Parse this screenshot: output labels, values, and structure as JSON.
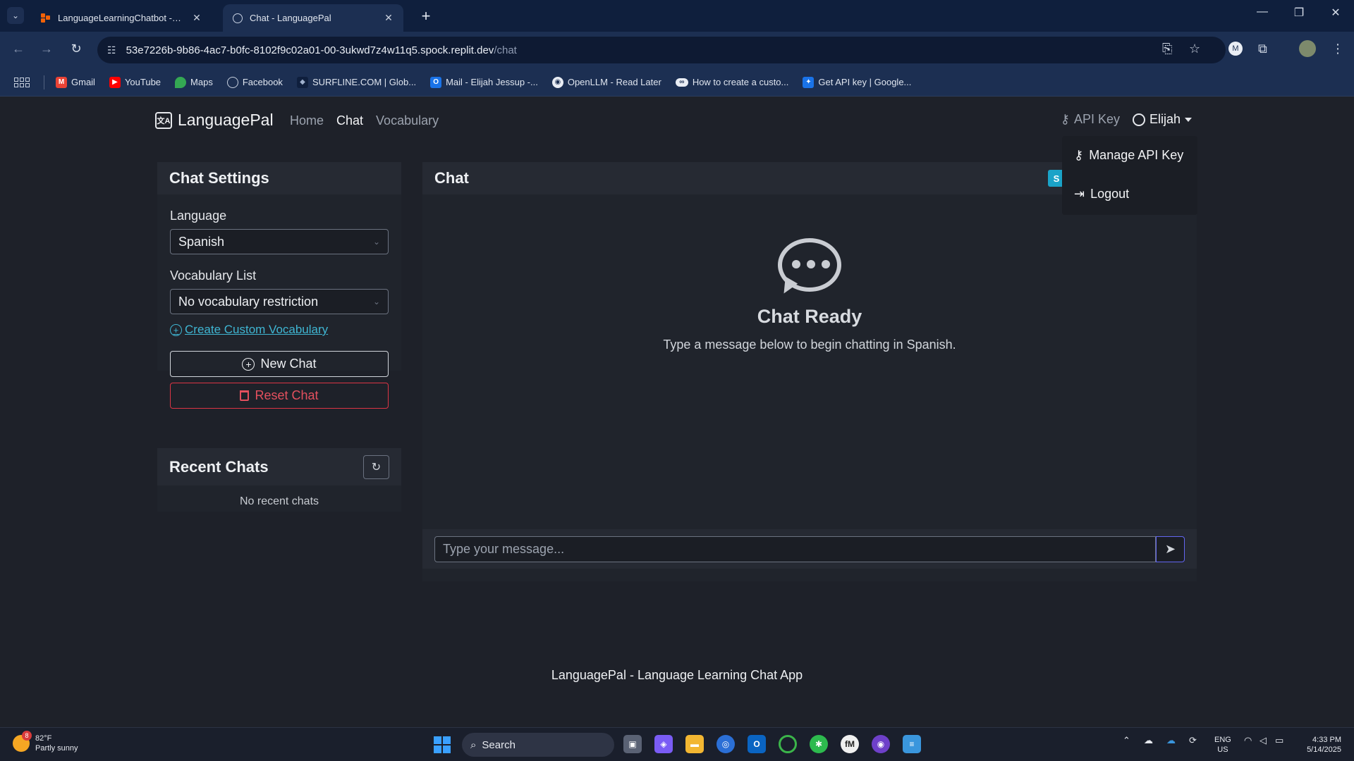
{
  "browser": {
    "tabs": [
      {
        "title": "LanguageLearningChatbot - Replit",
        "active": false
      },
      {
        "title": "Chat - LanguagePal",
        "active": true
      }
    ],
    "url_host": "53e7226b-9b86-4ac7-b0fc-8102f9c02a01-00-3ukwd7z4w11q5.spock.replit.dev",
    "url_path": "/chat",
    "bookmarks": [
      {
        "label": "Gmail",
        "icon": "gmail-icon",
        "color": "#ea4335"
      },
      {
        "label": "YouTube",
        "icon": "youtube-icon",
        "color": "#ff0000"
      },
      {
        "label": "Maps",
        "icon": "maps-icon",
        "color": "#34a853"
      },
      {
        "label": "Facebook",
        "icon": "globe-icon",
        "color": "#8a94a8"
      },
      {
        "label": "SURFLINE.COM | Glob...",
        "icon": "surfline-icon",
        "color": "#1f2b44"
      },
      {
        "label": "Mail - Elijah Jessup -...",
        "icon": "outlook-icon",
        "color": "#1a73e8"
      },
      {
        "label": "OpenLLM - Read Later",
        "icon": "github-icon",
        "color": "#2b2b2b"
      },
      {
        "label": "How to create a custo...",
        "icon": "link-icon",
        "color": "#444c5e"
      },
      {
        "label": "Get API key | Google...",
        "icon": "google-ai-icon",
        "color": "#1a73e8"
      }
    ]
  },
  "app": {
    "brand": "LanguagePal",
    "nav": {
      "home": "Home",
      "chat": "Chat",
      "vocabulary": "Vocabulary"
    },
    "api_key": "API Key",
    "user": "Elijah",
    "dropdown": {
      "manage_api_key": "Manage API Key",
      "logout": "Logout"
    },
    "settings": {
      "title": "Chat Settings",
      "language_label": "Language",
      "language_value": "Spanish",
      "vocab_label": "Vocabulary List",
      "vocab_value": "No vocabulary restriction",
      "create_custom": "Create Custom Vocabulary",
      "new_chat": "New Chat",
      "reset_chat": "Reset Chat"
    },
    "recent": {
      "title": "Recent Chats",
      "empty": "No recent chats"
    },
    "chat": {
      "title": "Chat",
      "badge": "S",
      "ready_title": "Chat Ready",
      "ready_hint": "Type a message below to begin chatting in Spanish.",
      "input_placeholder": "Type your message..."
    },
    "footer": "LanguagePal - Language Learning Chat App"
  },
  "taskbar": {
    "weather_temp": "82°F",
    "weather_desc": "Partly sunny",
    "weather_badge": "8",
    "search": "Search",
    "lang_top": "ENG",
    "lang_bottom": "US",
    "time": "4:33 PM",
    "date": "5/14/2025"
  },
  "colors": {
    "accent": "#3fb6d3",
    "danger": "#dc3545",
    "send_border": "#6366f1",
    "page_bg": "#1e2129"
  }
}
